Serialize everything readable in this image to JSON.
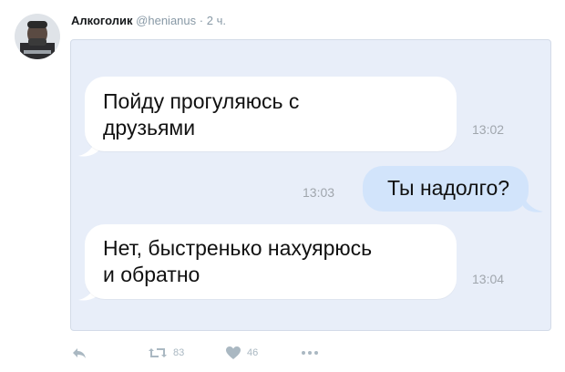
{
  "tweet": {
    "author": "Алкоголик",
    "handle": "@henianus",
    "separator": "·",
    "time": "2 ч."
  },
  "chat": {
    "messages": [
      {
        "direction": "incoming",
        "lines": [
          "Пойду прогуляюсь с",
          "друзьями"
        ],
        "time": "13:02"
      },
      {
        "direction": "outgoing",
        "lines": [
          "Ты надолго?"
        ],
        "time": "13:03"
      },
      {
        "direction": "incoming",
        "lines": [
          "Нет, быстренько нахуярюсь",
          "и обратно"
        ],
        "time": "13:04"
      }
    ]
  },
  "actions": {
    "reply_icon": "reply-icon",
    "retweet_icon": "retweet-icon",
    "retweet_count": "83",
    "like_icon": "heart-icon",
    "like_count": "46",
    "more_icon": "more-icon"
  },
  "colors": {
    "photo_bg": "#e8eef9",
    "outgoing_bubble": "#d2e4fb",
    "incoming_bubble": "#ffffff",
    "muted": "#aab8c2"
  }
}
